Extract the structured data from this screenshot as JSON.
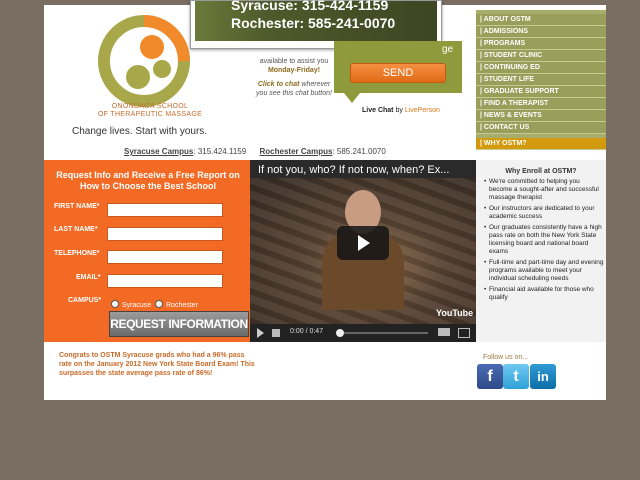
{
  "popup": {
    "line1": "Syracuse: 315-424-1159",
    "line2": "Rochester: 585-241-0070"
  },
  "logo": {
    "line1": "ONONDAGA SCHOOL",
    "line2": "OF THERAPEUTIC MASSAGE",
    "tagline": "Change lives. Start with yours."
  },
  "chat": {
    "line1": "available to assist you",
    "line2": "Monday-Friday!",
    "click": "Click to chat",
    "click_rest": "wherever you see this chat button!",
    "head": "ge",
    "send": "SEND",
    "livechat": "Live Chat",
    "by": "by",
    "liveperson": "LivePerson"
  },
  "nav": [
    "| ABOUT OSTM",
    "| ADMISSIONS",
    "| PROGRAMS",
    "| STUDENT CLINIC",
    "| CONTINUING ED",
    "| STUDENT LIFE",
    "| GRADUATE SUPPORT",
    "| FIND A THERAPIST",
    "| NEWS & EVENTS",
    "| CONTACT US",
    "| WHY OSTM?"
  ],
  "campus": {
    "syr_label": "Syracuse Campus",
    "syr_phone": ": 315.424.1159",
    "roc_label": "Rochester Campus",
    "roc_phone": ": 585.241.0070"
  },
  "form": {
    "title": "Request Info and Receive a Free Report on How to Choose the Best School",
    "first": "FIRST NAME*",
    "last": "LAST NAME*",
    "phone": "TELEPHONE*",
    "email": "EMAIL*",
    "campus": "CAMPUS*",
    "opt1": "Syracuse",
    "opt2": "Rochester",
    "button": "REQUEST INFORMATION"
  },
  "video": {
    "title": "If not you, who? If not now, when? Ex...",
    "time": "0:00 / 0:47",
    "youtube": "YouTube"
  },
  "why": {
    "title": "Why Enroll at OSTM?",
    "items": [
      "We're committed to helping you become a sought-after and successful massage therapist",
      "Our instructors are dedicated to your academic success",
      "Our graduates consistently have a high pass rate on both the New York State licensing board and national board exams",
      "Full-time and part-time day and evening programs available to meet your individual scheduling needs",
      "Financial aid available for those who qualify"
    ]
  },
  "congrats": "Congrats to OSTM Syracuse grads who had a 96% pass rate on the January 2012 New York State Board Exam! This surpasses the state average pass rate of 86%!",
  "follow": "Follow us on..."
}
